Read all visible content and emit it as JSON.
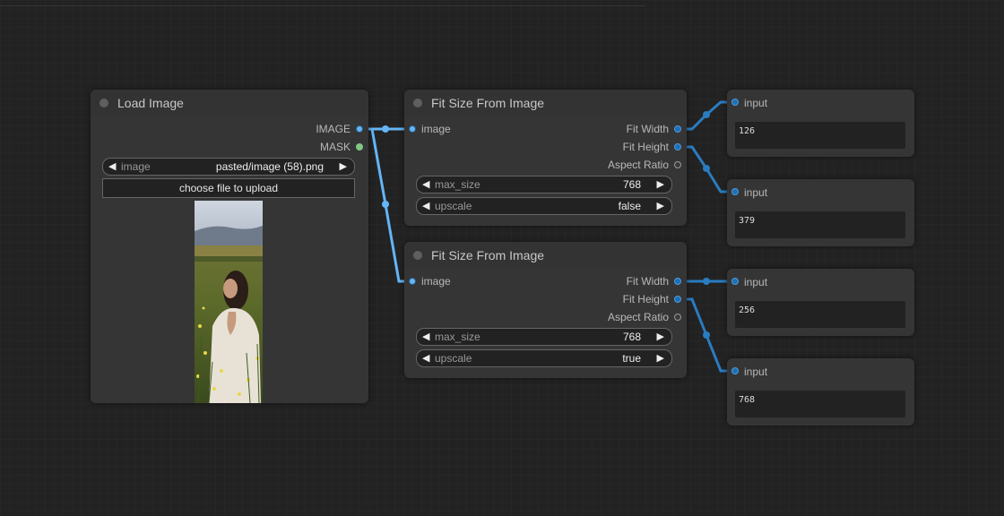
{
  "colors": {
    "canvas": "#222222",
    "node_body": "#353535",
    "link_image": "#64b5f6",
    "link_int": "#2a7cc1"
  },
  "nodes": {
    "load_image": {
      "title": "Load Image",
      "outputs": [
        "IMAGE",
        "MASK"
      ],
      "image_widget": {
        "label": "image",
        "value": "pasted/image (58).png"
      },
      "upload_label": "choose file to upload",
      "preview_alt": "photo of woman in a flower field"
    },
    "fit_size_1": {
      "title": "Fit Size From Image",
      "input": "image",
      "outputs": [
        "Fit Width",
        "Fit Height",
        "Aspect Ratio"
      ],
      "widgets": [
        {
          "label": "max_size",
          "value": "768"
        },
        {
          "label": "upscale",
          "value": "false"
        }
      ]
    },
    "fit_size_2": {
      "title": "Fit Size From Image",
      "input": "image",
      "outputs": [
        "Fit Width",
        "Fit Height",
        "Aspect Ratio"
      ],
      "widgets": [
        {
          "label": "max_size",
          "value": "768"
        },
        {
          "label": "upscale",
          "value": "true"
        }
      ]
    },
    "inputs": [
      {
        "label": "input",
        "value": "126"
      },
      {
        "label": "input",
        "value": "379"
      },
      {
        "label": "input",
        "value": "256"
      },
      {
        "label": "input",
        "value": "768"
      }
    ]
  },
  "glyphs": {
    "left": "◀",
    "right": "▶"
  }
}
